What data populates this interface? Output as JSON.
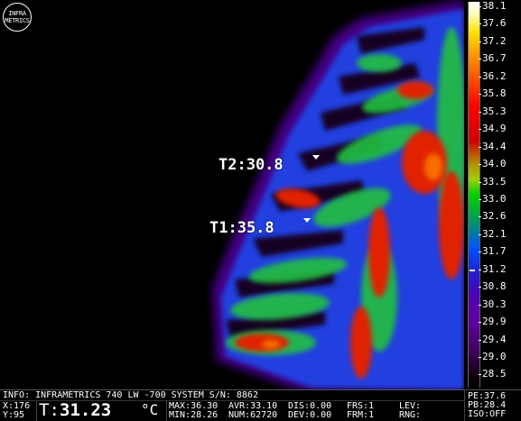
{
  "logo": {
    "line1": "INFRA",
    "line2": "METRICS"
  },
  "markers": [
    {
      "label": "T2:30.8"
    },
    {
      "label": "T1:35.8"
    }
  ],
  "scale": {
    "labels": [
      "38.1",
      "37.6",
      "37.2",
      "36.7",
      "36.2",
      "35.8",
      "35.3",
      "34.9",
      "34.4",
      "34.0",
      "33.5",
      "33.0",
      "32.6",
      "32.1",
      "31.7",
      "31.2",
      "30.8",
      "30.3",
      "29.9",
      "29.4",
      "29.0",
      "28.5"
    ]
  },
  "status": {
    "info": "INFO: INFRAMETRICS 740 LW -700 SYSTEM S/N: 8862",
    "x": "X:176",
    "y": "Y:95",
    "t_label": "T:",
    "t_value": "31.23",
    "t_unit": "°C",
    "max": "MAX:36.30",
    "min": "MIN:28.26",
    "avr": "AVR:33.10",
    "num": "NUM:62720",
    "dis": "DIS:0.00",
    "dev": "DEV:0.00",
    "frs": "FRS:1",
    "frm": "FRM:1",
    "lev": "LEV:",
    "rng": "RNG:",
    "pe": "PE:37.6",
    "pb": "PB:28.4",
    "iso": "ISO:OFF"
  }
}
